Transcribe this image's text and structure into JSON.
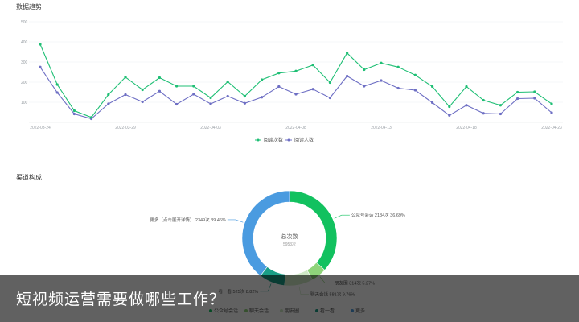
{
  "sections": {
    "trend_title": "数据趋势",
    "channel_title": "渠道构成"
  },
  "overlay": {
    "caption": "短视频运营需要做哪些工作？"
  },
  "colors": {
    "series_reads": "#1fbf75",
    "series_readers": "#6e6fc4",
    "donut": [
      "#12c15f",
      "#8fd37a",
      "#cfe9c6",
      "#1a9e86",
      "#4a9be0"
    ]
  },
  "chart_data": [
    {
      "type": "line",
      "ylim": [
        0,
        500
      ],
      "y_ticks": [
        "100",
        "200",
        "300",
        "400",
        "500"
      ],
      "x_tick_labels": [
        "2022-03-24",
        "2022-03-29",
        "2022-04-03",
        "2022-04-08",
        "2022-04-13",
        "2022-04-18",
        "2022-04-23"
      ],
      "x": [
        "2022-03-24",
        "2022-03-25",
        "2022-03-26",
        "2022-03-27",
        "2022-03-28",
        "2022-03-29",
        "2022-03-30",
        "2022-03-31",
        "2022-04-01",
        "2022-04-02",
        "2022-04-03",
        "2022-04-04",
        "2022-04-05",
        "2022-04-06",
        "2022-04-07",
        "2022-04-08",
        "2022-04-09",
        "2022-04-10",
        "2022-04-11",
        "2022-04-12",
        "2022-04-13",
        "2022-04-14",
        "2022-04-15",
        "2022-04-16",
        "2022-04-17",
        "2022-04-18",
        "2022-04-19",
        "2022-04-20",
        "2022-04-21",
        "2022-04-22",
        "2022-04-23"
      ],
      "series": [
        {
          "name": "阅读次数",
          "values": [
            388,
            188,
            58,
            25,
            138,
            225,
            162,
            222,
            180,
            180,
            122,
            202,
            130,
            212,
            245,
            255,
            285,
            198,
            345,
            262,
            295,
            275,
            235,
            178,
            78,
            178,
            110,
            85,
            150,
            152,
            92
          ]
        },
        {
          "name": "阅读人数",
          "values": [
            275,
            148,
            42,
            18,
            92,
            138,
            102,
            155,
            90,
            140,
            92,
            130,
            95,
            125,
            178,
            140,
            165,
            122,
            230,
            180,
            208,
            170,
            160,
            98,
            35,
            85,
            45,
            42,
            118,
            120,
            48
          ]
        }
      ],
      "legend_position": "bottom-center",
      "grid": true
    },
    {
      "type": "pie",
      "donut": true,
      "center_title": "总次数",
      "center_value": "5953次",
      "legend_position": "bottom-center",
      "slices": [
        {
          "name": "公众号会话",
          "value": 2184,
          "label": "公众号会话 2184次 36.69%"
        },
        {
          "name": "朋友圈",
          "value": 314,
          "label": "朋友圈 314次 5.27%"
        },
        {
          "name": "聊天会话",
          "value": 581,
          "label": "聊天会话 581次 9.76%"
        },
        {
          "name": "看一看",
          "value": 525,
          "label": "看一看 525次 8.82%"
        },
        {
          "name": "更多（点击展开详情）",
          "value": 2349,
          "label": "更多（点击展开详情） 2349次 39.46%"
        }
      ],
      "legend": [
        "公众号会话",
        "聊天会话",
        "朋友圈",
        "看一看",
        "更多"
      ]
    }
  ]
}
